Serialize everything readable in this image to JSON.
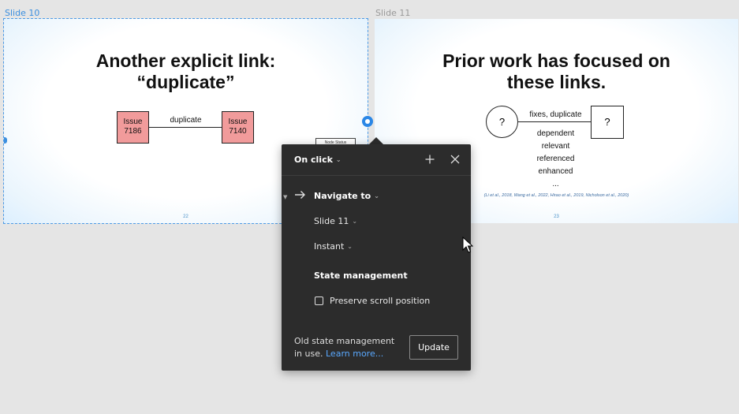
{
  "frames": {
    "slide10_label": "Slide 10",
    "slide11_label": "Slide 11"
  },
  "slide10": {
    "title_line1": "Another explicit link:",
    "title_line2": "“duplicate”",
    "issue_a": [
      "Issue",
      "7186"
    ],
    "issue_b": [
      "Issue",
      "7140"
    ],
    "edge_label": "duplicate",
    "mini_node": "Node Status",
    "page_number": "22"
  },
  "slide11": {
    "title_line1": "Prior work has focused on",
    "title_line2": "these links.",
    "circle_node": "?",
    "square_node": "?",
    "edge_label": "fixes, duplicate",
    "link_types": [
      "dependent",
      "relevant",
      "referenced",
      "enhanced",
      "..."
    ],
    "citation": "(Li et al., 2018, Wang et al., 2022, Hirao et al., 2019, Nicholson et al., 2020)",
    "page_number": "23"
  },
  "interaction_panel": {
    "trigger": "On click",
    "add_icon": "plus-icon",
    "close_icon": "close-icon",
    "action": "Navigate to",
    "destination": "Slide 11",
    "animation": "Instant",
    "section_title": "State management",
    "checkbox_label": "Preserve scroll position",
    "checkbox_checked": false,
    "footer_line1": "Old state management",
    "footer_line2_prefix": "in use.",
    "footer_link": "Learn more...",
    "update_button": "Update"
  },
  "colors": {
    "selection_blue": "#3b8fe0",
    "issue_fill": "#f19b9b",
    "panel_bg": "#2c2c2c",
    "link_blue": "#5aa9ff"
  }
}
